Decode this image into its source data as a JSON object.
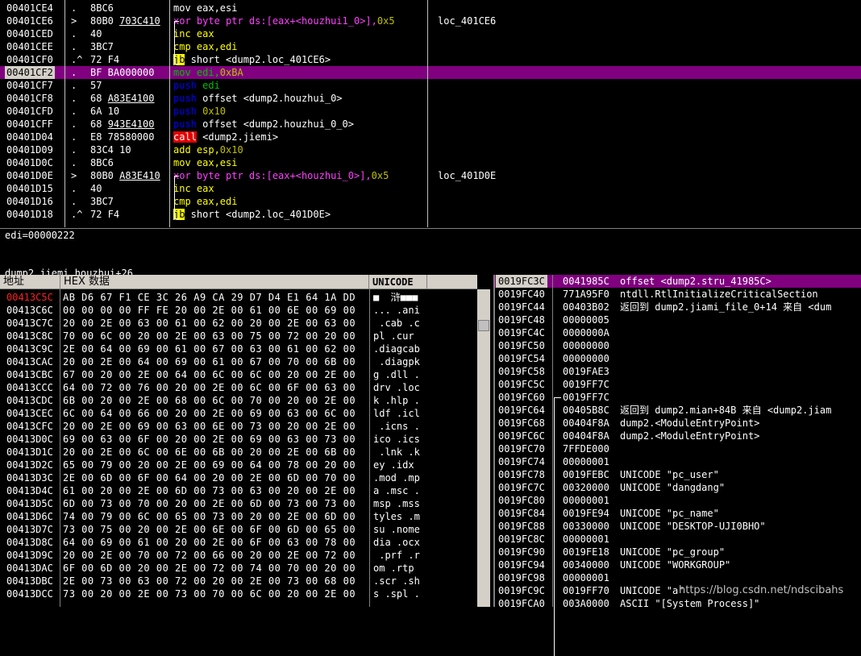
{
  "disasm": {
    "rows": [
      {
        "addr": "00401CE4",
        "mk": ".",
        "hex": "8BC6",
        "hexu": "",
        "asm": [
          {
            "t": "mov eax,esi",
            "c": ""
          }
        ],
        "cmt": "",
        "sel": false
      },
      {
        "addr": "00401CE6",
        "mk": ">",
        "hex": "80B0 ",
        "hexu": "703C410",
        "asm": [
          {
            "t": "xor",
            "c": "kw-mag"
          },
          {
            "t": " byte ptr ds:[eax+<houzhui1_0>],",
            "c": "kw-mag"
          },
          {
            "t": "0x5",
            "c": "num"
          }
        ],
        "cmt": "loc_401CE6",
        "sel": false
      },
      {
        "addr": "00401CED",
        "mk": ".",
        "hex": "40",
        "hexu": "",
        "asm": [
          {
            "t": "inc eax",
            "c": "kw-yel"
          }
        ],
        "cmt": "",
        "sel": false
      },
      {
        "addr": "00401CEE",
        "mk": ".",
        "hex": "3BC7",
        "hexu": "",
        "asm": [
          {
            "t": "cmp eax,edi",
            "c": "kw-yel"
          }
        ],
        "cmt": "",
        "sel": false
      },
      {
        "addr": "00401CF0",
        "mk": ".^",
        "hex": "72 F4",
        "hexu": "",
        "asm": [
          {
            "t": "jb",
            "c": "kw-jb"
          },
          {
            "t": " short <dump2.loc_401CE6>",
            "c": ""
          }
        ],
        "cmt": "",
        "sel": false
      },
      {
        "addr": "00401CF2",
        "mk": ".",
        "hex": "BF BA000000",
        "hexu": "",
        "asm": [
          {
            "t": "mov edi,",
            "c": "kw-grn"
          },
          {
            "t": "0xBA",
            "c": "num"
          }
        ],
        "cmt": "",
        "sel": true
      },
      {
        "addr": "00401CF7",
        "mk": ".",
        "hex": "57",
        "hexu": "",
        "asm": [
          {
            "t": "push",
            "c": "kw-push"
          },
          {
            "t": " edi",
            "c": "kw-grn"
          }
        ],
        "cmt": "",
        "sel": false
      },
      {
        "addr": "00401CF8",
        "mk": ".",
        "hex": "68 ",
        "hexu": "A83E4100",
        "asm": [
          {
            "t": "push",
            "c": "kw-push"
          },
          {
            "t": " offset <dump2.houzhui_0>",
            "c": ""
          }
        ],
        "cmt": "",
        "sel": false
      },
      {
        "addr": "00401CFD",
        "mk": ".",
        "hex": "6A 10",
        "hexu": "",
        "asm": [
          {
            "t": "push",
            "c": "kw-push"
          },
          {
            "t": " 0x10",
            "c": "num"
          }
        ],
        "cmt": "",
        "sel": false
      },
      {
        "addr": "00401CFF",
        "mk": ".",
        "hex": "68 ",
        "hexu": "943E4100",
        "asm": [
          {
            "t": "push",
            "c": "kw-push"
          },
          {
            "t": " offset <dump2.houzhui_0_0>",
            "c": ""
          }
        ],
        "cmt": "",
        "sel": false
      },
      {
        "addr": "00401D04",
        "mk": ".",
        "hex": "E8 78580000",
        "hexu": "",
        "asm": [
          {
            "t": "call",
            "c": "kw-call"
          },
          {
            "t": " <dump2.jiemi>",
            "c": ""
          }
        ],
        "cmt": "",
        "sel": false
      },
      {
        "addr": "00401D09",
        "mk": ".",
        "hex": "83C4 10",
        "hexu": "",
        "asm": [
          {
            "t": "add esp,",
            "c": "kw-yel"
          },
          {
            "t": "0x10",
            "c": "num"
          }
        ],
        "cmt": "",
        "sel": false
      },
      {
        "addr": "00401D0C",
        "mk": ".",
        "hex": "8BC6",
        "hexu": "",
        "asm": [
          {
            "t": "mov eax,esi",
            "c": "kw-yel"
          }
        ],
        "cmt": "",
        "sel": false
      },
      {
        "addr": "00401D0E",
        "mk": ">",
        "hex": "80B0 ",
        "hexu": "A83E410",
        "asm": [
          {
            "t": "xor",
            "c": "kw-mag"
          },
          {
            "t": " byte ptr ds:[eax+<houzhui_0>],",
            "c": "kw-mag"
          },
          {
            "t": "0x5",
            "c": "num"
          }
        ],
        "cmt": "loc_401D0E",
        "sel": false
      },
      {
        "addr": "00401D15",
        "mk": ".",
        "hex": "40",
        "hexu": "",
        "asm": [
          {
            "t": "inc eax",
            "c": "kw-yel"
          }
        ],
        "cmt": "",
        "sel": false
      },
      {
        "addr": "00401D16",
        "mk": ".",
        "hex": "3BC7",
        "hexu": "",
        "asm": [
          {
            "t": "cmp eax,edi",
            "c": "kw-yel"
          }
        ],
        "cmt": "",
        "sel": false
      },
      {
        "addr": "00401D18",
        "mk": ".^",
        "hex": "72 F4",
        "hexu": "",
        "asm": [
          {
            "t": "jb",
            "c": "kw-jb"
          },
          {
            "t": " short <dump2.loc_401D0E>",
            "c": ""
          }
        ],
        "cmt": "",
        "sel": false
      }
    ]
  },
  "info": {
    "line1": "edi=00000222",
    "line2": "dump2.jiemi.houzhui+26"
  },
  "dump": {
    "headers": {
      "addr": "地址",
      "hex": "HEX 数据",
      "unicode": "UNICODE"
    },
    "rows": [
      {
        "a": "00413C5C",
        "h": "AB D6 67 F1 CE 3C 26 A9 CA 29 D7 D4 E1 64 1A DD",
        "u": "■  浒■■■",
        "hl": true
      },
      {
        "a": "00413C6C",
        "h": "00 00 00 00 FF FE 20 00 2E 00 61 00 6E 00 69 00",
        "u": "... .ani",
        "hl": false
      },
      {
        "a": "00413C7C",
        "h": "20 00 2E 00 63 00 61 00 62 00 20 00 2E 00 63 00",
        "u": " .cab .c",
        "hl": false
      },
      {
        "a": "00413C8C",
        "h": "70 00 6C 00 20 00 2E 00 63 00 75 00 72 00 20 00",
        "u": "pl .cur ",
        "hl": false
      },
      {
        "a": "00413C9C",
        "h": "2E 00 64 00 69 00 61 00 67 00 63 00 61 00 62 00",
        "u": ".diagcab",
        "hl": false
      },
      {
        "a": "00413CAC",
        "h": "20 00 2E 00 64 00 69 00 61 00 67 00 70 00 6B 00",
        "u": " .diagpk",
        "hl": false
      },
      {
        "a": "00413CBC",
        "h": "67 00 20 00 2E 00 64 00 6C 00 6C 00 20 00 2E 00",
        "u": "g .dll .",
        "hl": false
      },
      {
        "a": "00413CCC",
        "h": "64 00 72 00 76 00 20 00 2E 00 6C 00 6F 00 63 00",
        "u": "drv .loc",
        "hl": false
      },
      {
        "a": "00413CDC",
        "h": "6B 00 20 00 2E 00 68 00 6C 00 70 00 20 00 2E 00",
        "u": "k .hlp .",
        "hl": false
      },
      {
        "a": "00413CEC",
        "h": "6C 00 64 00 66 00 20 00 2E 00 69 00 63 00 6C 00",
        "u": "ldf .icl",
        "hl": false
      },
      {
        "a": "00413CFC",
        "h": "20 00 2E 00 69 00 63 00 6E 00 73 00 20 00 2E 00",
        "u": " .icns .",
        "hl": false
      },
      {
        "a": "00413D0C",
        "h": "69 00 63 00 6F 00 20 00 2E 00 69 00 63 00 73 00",
        "u": "ico .ics",
        "hl": false
      },
      {
        "a": "00413D1C",
        "h": "20 00 2E 00 6C 00 6E 00 6B 00 20 00 2E 00 6B 00",
        "u": " .lnk .k",
        "hl": false
      },
      {
        "a": "00413D2C",
        "h": "65 00 79 00 20 00 2E 00 69 00 64 00 78 00 20 00",
        "u": "ey .idx ",
        "hl": false
      },
      {
        "a": "00413D3C",
        "h": "2E 00 6D 00 6F 00 64 00 20 00 2E 00 6D 00 70 00",
        "u": ".mod .mp",
        "hl": false
      },
      {
        "a": "00413D4C",
        "h": "61 00 20 00 2E 00 6D 00 73 00 63 00 20 00 2E 00",
        "u": "a .msc .",
        "hl": false
      },
      {
        "a": "00413D5C",
        "h": "6D 00 73 00 70 00 20 00 2E 00 6D 00 73 00 73 00",
        "u": "msp .mss",
        "hl": false
      },
      {
        "a": "00413D6C",
        "h": "74 00 79 00 6C 00 65 00 73 00 20 00 2E 00 6D 00",
        "u": "tyles .m",
        "hl": false
      },
      {
        "a": "00413D7C",
        "h": "73 00 75 00 20 00 2E 00 6E 00 6F 00 6D 00 65 00",
        "u": "su .nome",
        "hl": false
      },
      {
        "a": "00413D8C",
        "h": "64 00 69 00 61 00 20 00 2E 00 6F 00 63 00 78 00",
        "u": "dia .ocx",
        "hl": false
      },
      {
        "a": "00413D9C",
        "h": "20 00 2E 00 70 00 72 00 66 00 20 00 2E 00 72 00",
        "u": " .prf .r",
        "hl": false
      },
      {
        "a": "00413DAC",
        "h": "6F 00 6D 00 20 00 2E 00 72 00 74 00 70 00 20 00",
        "u": "om .rtp ",
        "hl": false
      },
      {
        "a": "00413DBC",
        "h": "2E 00 73 00 63 00 72 00 20 00 2E 00 73 00 68 00",
        "u": ".scr .sh",
        "hl": false
      },
      {
        "a": "00413DCC",
        "h": "73 00 20 00 2E 00 73 00 70 00 6C 00 20 00 2E 00",
        "u": "s .spl .",
        "hl": false
      }
    ]
  },
  "stack": {
    "rows": [
      {
        "a": "0019FC3C",
        "v": "0041985C",
        "c": "offset <dump2.stru_41985C>",
        "sel": true
      },
      {
        "a": "0019FC40",
        "v": "771A95F0",
        "c": "ntdll.RtlInitializeCriticalSection",
        "sel": false
      },
      {
        "a": "0019FC44",
        "v": "00403B02",
        "c": "返回到 dump2.jiami_file_0+14 来自 <dum",
        "sel": false
      },
      {
        "a": "0019FC48",
        "v": "00000005",
        "c": "",
        "sel": false
      },
      {
        "a": "0019FC4C",
        "v": "0000000A",
        "c": "",
        "sel": false
      },
      {
        "a": "0019FC50",
        "v": "00000000",
        "c": "",
        "sel": false
      },
      {
        "a": "0019FC54",
        "v": "00000000",
        "c": "",
        "sel": false
      },
      {
        "a": "0019FC58",
        "v": "0019FAE3",
        "c": "",
        "sel": false
      },
      {
        "a": "0019FC5C",
        "v": "0019FF7C",
        "c": "",
        "sel": false
      },
      {
        "a": "0019FC60",
        "v": "0019FF7C",
        "c": "",
        "sel": false
      },
      {
        "a": "0019FC64",
        "v": "00405B8C",
        "c": "返回到 dump2.mian+84B 来自 <dump2.jiam",
        "sel": false
      },
      {
        "a": "0019FC68",
        "v": "00404F8A",
        "c": "dump2.<ModuleEntryPoint>",
        "sel": false
      },
      {
        "a": "0019FC6C",
        "v": "00404F8A",
        "c": "dump2.<ModuleEntryPoint>",
        "sel": false
      },
      {
        "a": "0019FC70",
        "v": "7FFDE000",
        "c": "",
        "sel": false
      },
      {
        "a": "0019FC74",
        "v": "00000001",
        "c": "",
        "sel": false
      },
      {
        "a": "0019FC78",
        "v": "0019FEBC",
        "c": "UNICODE \"pc_user\"",
        "sel": false
      },
      {
        "a": "0019FC7C",
        "v": "00320000",
        "c": "UNICODE \"dangdang\"",
        "sel": false
      },
      {
        "a": "0019FC80",
        "v": "00000001",
        "c": "",
        "sel": false
      },
      {
        "a": "0019FC84",
        "v": "0019FE94",
        "c": "UNICODE \"pc_name\"",
        "sel": false
      },
      {
        "a": "0019FC88",
        "v": "00330000",
        "c": "UNICODE \"DESKTOP-UJI0BHO\"",
        "sel": false
      },
      {
        "a": "0019FC8C",
        "v": "00000001",
        "c": "",
        "sel": false
      },
      {
        "a": "0019FC90",
        "v": "0019FE18",
        "c": "UNICODE \"pc_group\"",
        "sel": false
      },
      {
        "a": "0019FC94",
        "v": "00340000",
        "c": "UNICODE \"WORKGROUP\"",
        "sel": false
      },
      {
        "a": "0019FC98",
        "v": "00000001",
        "c": "",
        "sel": false
      },
      {
        "a": "0019FC9C",
        "v": "0019FF70",
        "c": "UNICODE \"a\"",
        "sel": false
      },
      {
        "a": "0019FCA0",
        "v": "003A0000",
        "c": "ASCII \"[System Process]\"",
        "sel": false
      }
    ]
  },
  "watermark": "https://blog.csdn.net/ndscibahs"
}
